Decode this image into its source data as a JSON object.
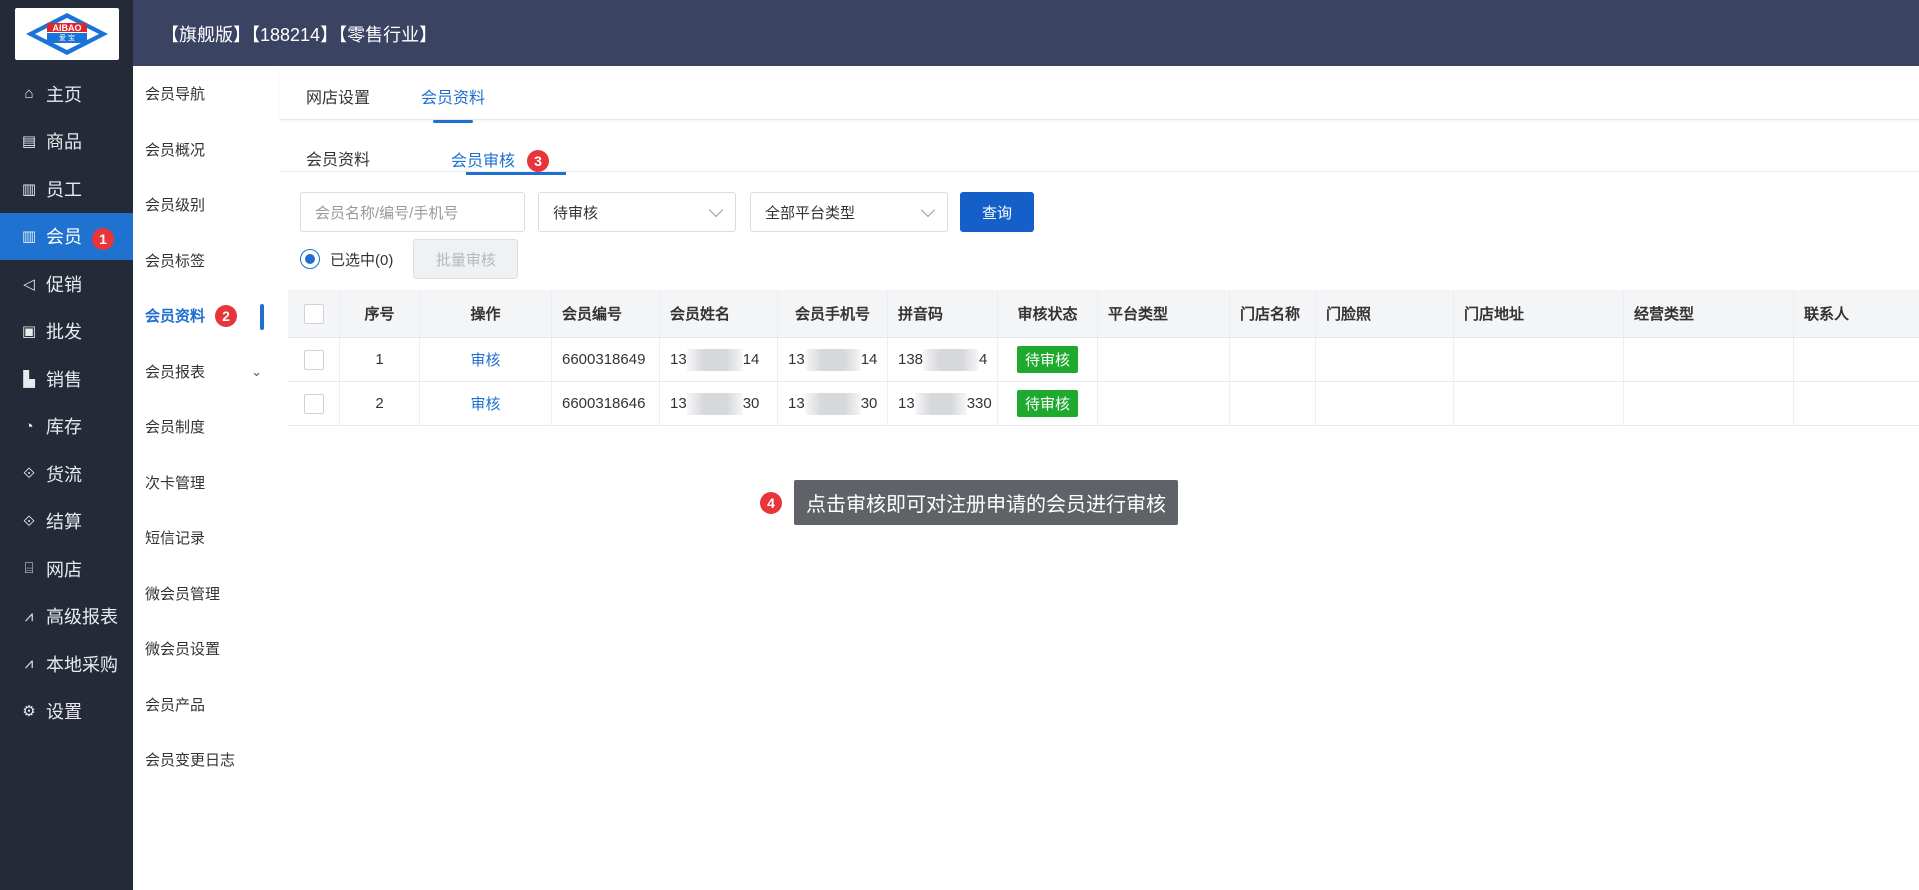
{
  "app": {
    "logo_text": "AIBAO",
    "logo_sub": "爱 宝",
    "header_title": "【旗舰版】【188214】【零售行业】"
  },
  "sidebar": {
    "items": [
      {
        "label": "主页",
        "icon": "home-icon",
        "glyph": "⌂"
      },
      {
        "label": "商品",
        "icon": "goods-icon",
        "glyph": "▤"
      },
      {
        "label": "员工",
        "icon": "staff-icon",
        "glyph": "▥"
      },
      {
        "label": "会员",
        "icon": "member-icon",
        "glyph": "▥"
      },
      {
        "label": "促销",
        "icon": "promo-icon",
        "glyph": "◁"
      },
      {
        "label": "批发",
        "icon": "wholesale-icon",
        "glyph": "▣"
      },
      {
        "label": "销售",
        "icon": "sales-icon",
        "glyph": "▙"
      },
      {
        "label": "库存",
        "icon": "stock-icon",
        "glyph": "◔"
      },
      {
        "label": "货流",
        "icon": "flow-icon",
        "glyph": "⟐"
      },
      {
        "label": "结算",
        "icon": "settle-icon",
        "glyph": "⟐"
      },
      {
        "label": "网店",
        "icon": "shop-icon",
        "glyph": "⌸"
      },
      {
        "label": "高级报表",
        "icon": "chart-icon",
        "glyph": "⩘"
      },
      {
        "label": "本地采购",
        "icon": "purchase-icon",
        "glyph": "⩘"
      },
      {
        "label": "设置",
        "icon": "settings-icon",
        "glyph": "⚙"
      }
    ],
    "active_badge": "1"
  },
  "submenu": {
    "items": [
      "会员导航",
      "会员概况",
      "会员级别",
      "会员标签",
      "会员资料",
      "会员报表",
      "会员制度",
      "次卡管理",
      "短信记录",
      "微会员管理",
      "微会员设置",
      "会员产品",
      "会员变更日志"
    ],
    "active_badge": "2"
  },
  "tabs_top": [
    "网店设置",
    "会员资料"
  ],
  "tabs_sub": {
    "items": [
      "会员资料",
      "会员审核"
    ],
    "badge": "3"
  },
  "filters": {
    "search_placeholder": "会员名称/编号/手机号",
    "status_value": "待审核",
    "platform_value": "全部平台类型",
    "query_label": "查询"
  },
  "selection": {
    "selected_label": "已选中(0)",
    "batch_label": "批量审核"
  },
  "table": {
    "headers": [
      "",
      "序号",
      "操作",
      "会员编号",
      "会员姓名",
      "会员手机号",
      "拼音码",
      "审核状态",
      "平台类型",
      "门店名称",
      "门脸照",
      "门店地址",
      "经营类型",
      "联系人"
    ],
    "rows": [
      {
        "index": "1",
        "action": "审核",
        "member_no": "6600318649",
        "name_a": "13",
        "name_b": "14",
        "phone_a": "13",
        "phone_b": "14",
        "pinyin_a": "138",
        "pinyin_b": "4",
        "status": "待审核"
      },
      {
        "index": "2",
        "action": "审核",
        "member_no": "6600318646",
        "name_a": "13",
        "name_b": "30",
        "phone_a": "13",
        "phone_b": "30",
        "pinyin_a": "13",
        "pinyin_b": "330",
        "status": "待审核"
      }
    ]
  },
  "tooltip": {
    "badge": "4",
    "text": "点击审核即可对注册申请的会员进行审核"
  },
  "colors": {
    "sidebar_bg": "#242a37",
    "topbar_bg": "#3b4363",
    "accent": "#1f6fd0",
    "badge_red": "#e8353a",
    "status_green": "#1faa2f"
  }
}
